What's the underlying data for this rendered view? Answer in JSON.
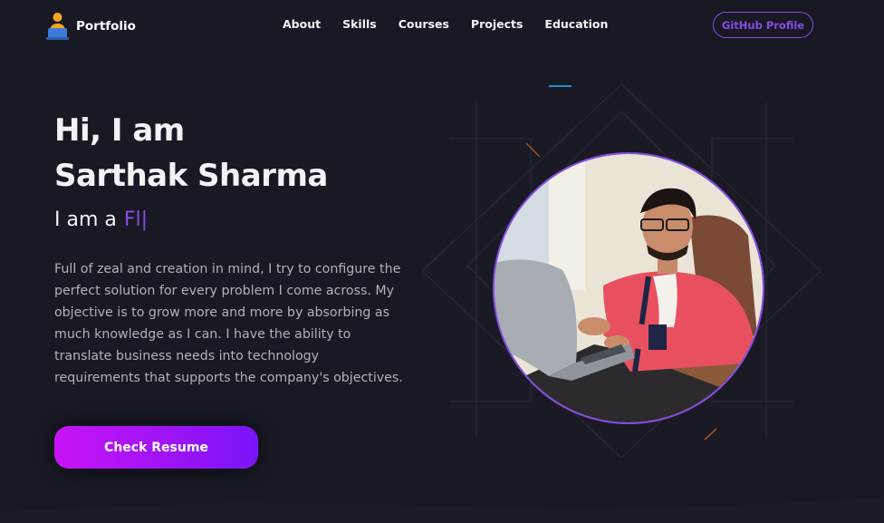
{
  "navbar": {
    "logo_text": "Portfolio",
    "links": [
      "About",
      "Skills",
      "Courses",
      "Projects",
      "Education"
    ],
    "github_label": "GitHub Profile"
  },
  "hero": {
    "greeting": "Hi, I am",
    "name": "Sarthak Sharma",
    "typer_prefix": "I am a",
    "typer_text": "Fl",
    "typer_cursor": "|",
    "description": "Full of zeal and creation in mind, I try to configure the perfect solution for every problem I come across. My objective is to grow more and more by absorbing as much knowledge as I can. I have the ability to translate business needs into technology requirements that supports the company's objectives.",
    "resume_label": "Check Resume"
  },
  "colors": {
    "background": "#1c1c27",
    "primary": "#854ce6",
    "text_primary": "#f2f3f4",
    "text_secondary": "#b1b2b3",
    "button_gradient_start": "#c814f5",
    "button_gradient_end": "#7b14f8"
  },
  "icons": {
    "logo": "person-at-laptop-icon"
  }
}
